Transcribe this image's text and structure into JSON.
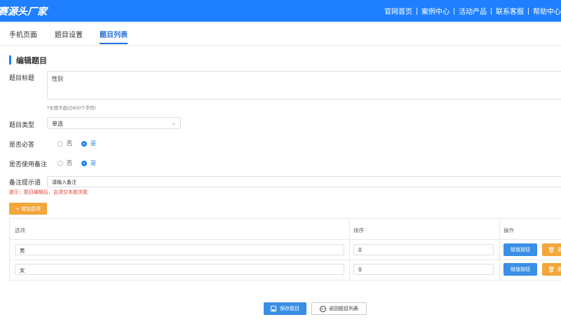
{
  "header": {
    "logo": "赛源头厂家",
    "nav": [
      "官网首页",
      "案例中心",
      "活动产品",
      "联系客服",
      "帮助中心"
    ]
  },
  "tabs": [
    "手机页面",
    "题目设置",
    "题目列表"
  ],
  "form": {
    "section_title": "编辑题目",
    "title_label": "题目标题",
    "title_value": "性别",
    "title_hint": "*长度不超过400个字符!",
    "type_label": "题目类型",
    "type_value": "单选",
    "required_label": "是否必答",
    "note_label": "是否使用备注",
    "no": "否",
    "yes": "是",
    "note_prompt_label": "备注提示语",
    "note_placeholder": "请输入备注",
    "warning": "提示：题目编辑后，会清空本题关联",
    "add_option": "+ 增加选项"
  },
  "table": {
    "headers": [
      "选项",
      "排序",
      "操作"
    ],
    "rows": [
      {
        "option": "男",
        "sort": "0"
      },
      {
        "option": "女",
        "sort": "0"
      }
    ],
    "assign_label": "赋值按钮",
    "delete_label": "删除"
  },
  "actions": {
    "save": "保存题目",
    "back": "返回题目列表"
  },
  "colors": {
    "primary": "#1f80ff",
    "orange": "#f3a63a",
    "warning": "#e2463b"
  }
}
